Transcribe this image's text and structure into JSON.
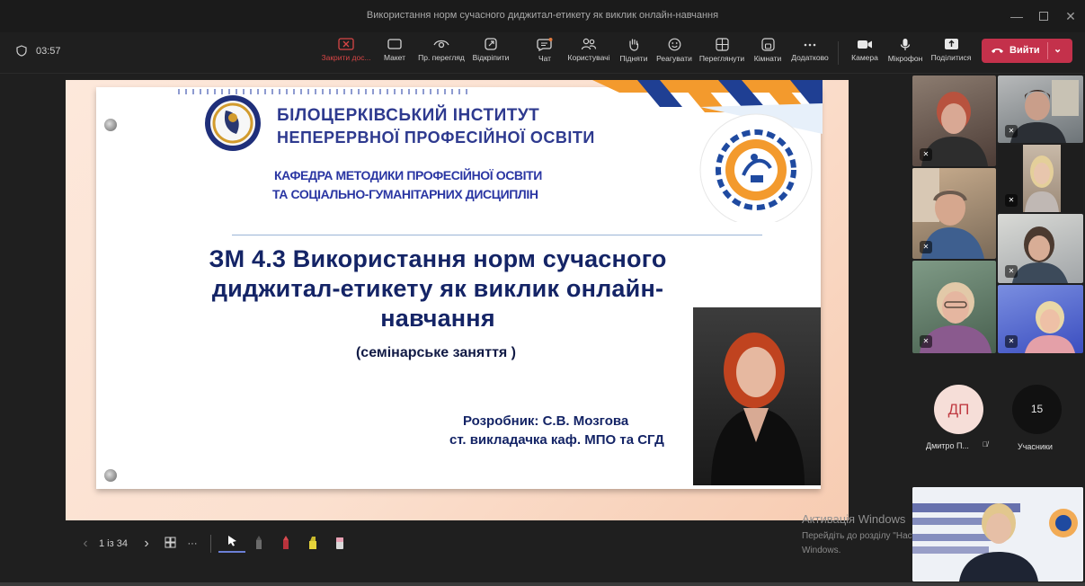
{
  "window": {
    "title": "Використання норм сучасного диджитал-етикету як виклик онлайн-навчання"
  },
  "meeting": {
    "timer": "03:57"
  },
  "toolbar": {
    "stop_share": "Закрити дос...",
    "layout": "Макет",
    "preview": "Пр. перегляд",
    "pop_out": "Відкріпити",
    "chat": "Чат",
    "people": "Користувачі",
    "raise": "Підняти",
    "react": "Реагувати",
    "view": "Переглянути",
    "rooms": "Кімнати",
    "more": "Додатково",
    "camera": "Камера",
    "mic": "Мікрофон",
    "share": "Поділитися",
    "leave": "Вийти"
  },
  "slide": {
    "org_line1": "БІЛОЦЕРКІВСЬКИЙ ІНСТИТУТ",
    "org_line2": "НЕПЕРЕРВНОЇ ПРОФЕСІЙНОЇ ОСВІТИ",
    "dept_line1": "КАФЕДРА МЕТОДИКИ ПРОФЕСІЙНОЇ ОСВІТИ",
    "dept_line2": "ТА СОЦІАЛЬНО-ГУМАНІТАРНИХ ДИСЦИПЛІН",
    "title_line1": "ЗМ 4.3 Використання норм сучасного",
    "title_line2": "диджитал-етикету як виклик онлайн-",
    "title_line3": "навчання",
    "subtitle": "(семінарське заняття )",
    "author_line1": "Розробник: С.В. Мозгова",
    "author_line2": "ст. викладачка каф. МПО та СГД"
  },
  "slide_controls": {
    "page": "1 із 34"
  },
  "watermark": {
    "line1": "Активація Windows",
    "line2": "Перейдіть до розділу \"Настройки\", щоб активувати",
    "line3": "Windows."
  },
  "participants": {
    "avatar_initials": "ДП",
    "avatar_name": "Дмитро П...",
    "count": "15",
    "count_label": "Учасники"
  },
  "colors": {
    "leave_red": "#c4314b",
    "title_navy": "#142466",
    "accent_orange": "#f39a2d"
  }
}
